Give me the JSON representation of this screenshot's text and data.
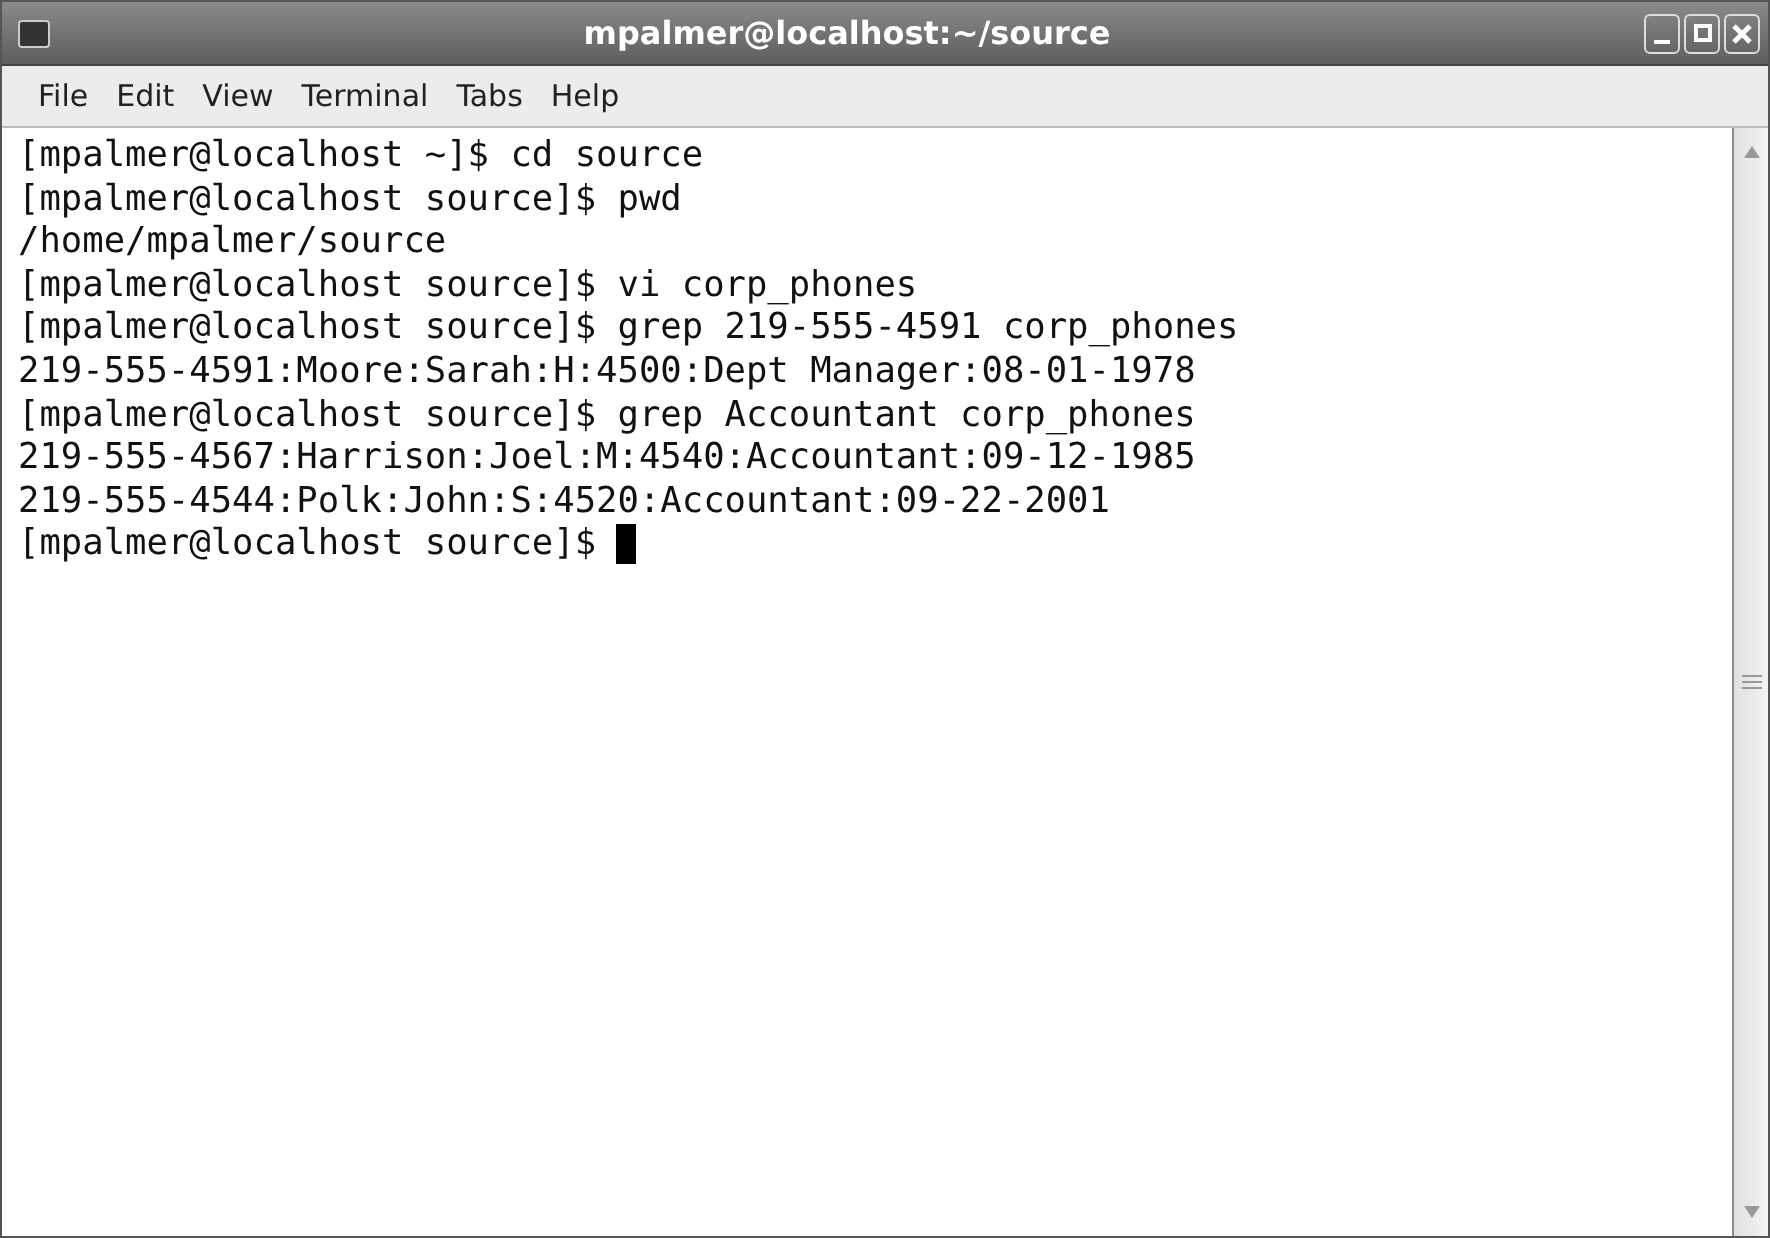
{
  "window": {
    "title": "mpalmer@localhost:~/source"
  },
  "menu": [
    "File",
    "Edit",
    "View",
    "Terminal",
    "Tabs",
    "Help"
  ],
  "terminal": {
    "lines": [
      "[mpalmer@localhost ~]$ cd source",
      "[mpalmer@localhost source]$ pwd",
      "/home/mpalmer/source",
      "[mpalmer@localhost source]$ vi corp_phones",
      "[mpalmer@localhost source]$ grep 219-555-4591 corp_phones",
      "219-555-4591:Moore:Sarah:H:4500:Dept Manager:08-01-1978",
      "[mpalmer@localhost source]$ grep Accountant corp_phones",
      "219-555-4567:Harrison:Joel:M:4540:Accountant:09-12-1985",
      "219-555-4544:Polk:John:S:4520:Accountant:09-22-2001"
    ],
    "prompt": "[mpalmer@localhost source]$"
  }
}
